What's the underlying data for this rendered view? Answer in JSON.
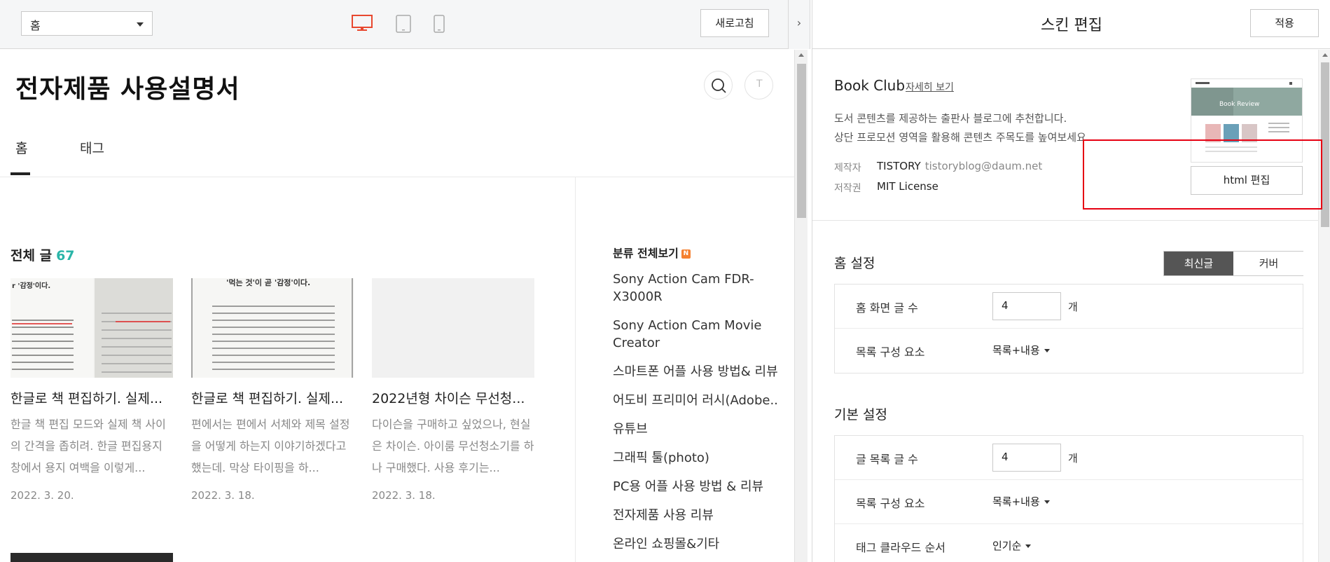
{
  "toolbar": {
    "page_select_value": "홈",
    "refresh_label": "새로고침",
    "collapse_glyph": "›",
    "accent_color": "#e8482f"
  },
  "blog": {
    "title": "전자제품 사용설명서",
    "write_glyph": "T",
    "nav": [
      {
        "label": "홈"
      },
      {
        "label": "태그"
      }
    ],
    "posts_heading": "전체 글",
    "posts_count": "67",
    "posts": [
      {
        "title": "한글로 책 편집하기. 실제...",
        "excerpt": "한글 책 편집 모드와 실제 책 사이의 간격을 좁히려. 한글 편집용지 창에서 용지 여백을 이렇게...",
        "date": "2022. 3. 20.",
        "thumb_caption": "'먹는 것'이 곧 '감정'이다."
      },
      {
        "title": "한글로 책 편집하기. 실제...",
        "excerpt": "편에서는 편에서 서체와 제목 설정을 어떻게 하는지 이야기하겠다고 했는데. 막상 타이핑을 하...",
        "date": "2022. 3. 18.",
        "thumb_caption": "'먹는 것'이 곧 '감정'이다."
      },
      {
        "title": "2022년형 차이슨 무선청...",
        "excerpt": "다이슨을 구매하고 싶었으나, 현실은 차이슨. 아이룸 무선청소기를 하나 구매했다. 사용 후기는...",
        "date": "2022. 3. 18.",
        "thumb_caption": ""
      }
    ],
    "categories_heading": "분류 전체보기",
    "new_badge": "N",
    "categories": [
      "Sony Action Cam FDR-X3000R",
      "Sony Action Cam Movie Creator",
      "스마트폰 어플 사용 방법& 리뷰",
      "어도비 프리미어 러시(Adobe..",
      "유튜브",
      "그래픽 툴(photo)",
      "PC용 어플 사용 방법 & 리뷰",
      "전자제품 사용 리뷰",
      "온라인 쇼핑몰&기타"
    ]
  },
  "panel": {
    "title": "스킨 편집",
    "apply_label": "적용",
    "skin": {
      "name": "Book Club",
      "detail_link": "자세히 보기",
      "desc_line1": "도서 콘텐츠를 제공하는 출판사 블로그에 추천합니다.",
      "desc_line2": "상단 프로모션 영역을 활용해 콘텐츠 주목도를 높여보세요.",
      "maker_label": "제작자",
      "maker": "TISTORY",
      "maker_email": "tistoryblog@daum.net",
      "license_label": "저작권",
      "license": "MIT License",
      "html_edit_label": "html 편집",
      "preview_caption": "Book Review",
      "highlight_color": "#e60012"
    },
    "home_settings": {
      "title": "홈 설정",
      "toggle": [
        "최신글",
        "커버"
      ],
      "selected": "최신글",
      "rows": [
        {
          "label": "홈 화면 글 수",
          "value": "4",
          "unit": "개"
        },
        {
          "label": "목록 구성 요소",
          "value": "목록+내용"
        }
      ]
    },
    "basic_settings": {
      "title": "기본 설정",
      "rows": [
        {
          "label": "글 목록 글 수",
          "value": "4",
          "unit": "개"
        },
        {
          "label": "목록 구성 요소",
          "value": "목록+내용"
        },
        {
          "label": "태그 클라우드 순서",
          "value": "인기순"
        }
      ]
    }
  }
}
